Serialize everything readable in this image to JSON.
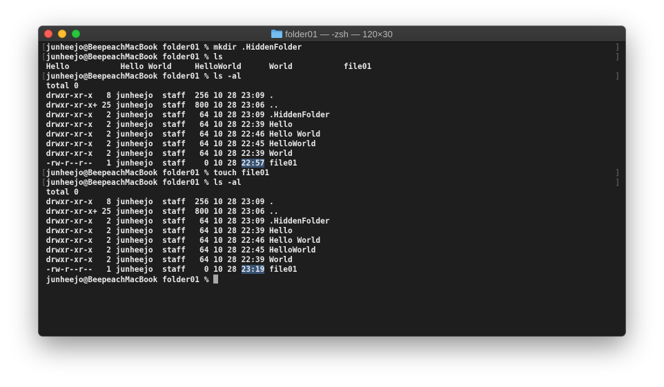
{
  "window": {
    "title": "folder01 — -zsh — 120×30",
    "title_icon": "folder-icon",
    "traffic_lights": {
      "close_color": "#fe5f57",
      "minimize_color": "#febc2e",
      "maximize_color": "#28c840"
    }
  },
  "terminal": {
    "background": "#1e1e1e",
    "text_color": "#e8e8e8",
    "selection_color": "#3a5472",
    "lines": [
      {
        "pre": "junheejo@BeepeachMacBook folder01 % mkdir .HiddenFolder",
        "hl": "",
        "post": "",
        "marked": true
      },
      {
        "pre": "junheejo@BeepeachMacBook folder01 % ls",
        "hl": "",
        "post": "",
        "marked": true
      },
      {
        "pre": "Hello           Hello World     HelloWorld      World           file01",
        "hl": "",
        "post": "",
        "marked": false
      },
      {
        "pre": "junheejo@BeepeachMacBook folder01 % ls -al",
        "hl": "",
        "post": "",
        "marked": true
      },
      {
        "pre": "total 0",
        "hl": "",
        "post": "",
        "marked": false
      },
      {
        "pre": "drwxr-xr-x   8 junheejo  staff  256 10 28 23:09 .",
        "hl": "",
        "post": "",
        "marked": false
      },
      {
        "pre": "drwxr-xr-x+ 25 junheejo  staff  800 10 28 23:06 ..",
        "hl": "",
        "post": "",
        "marked": false
      },
      {
        "pre": "drwxr-xr-x   2 junheejo  staff   64 10 28 23:09 .HiddenFolder",
        "hl": "",
        "post": "",
        "marked": false
      },
      {
        "pre": "drwxr-xr-x   2 junheejo  staff   64 10 28 22:39 Hello",
        "hl": "",
        "post": "",
        "marked": false
      },
      {
        "pre": "drwxr-xr-x   2 junheejo  staff   64 10 28 22:46 Hello World",
        "hl": "",
        "post": "",
        "marked": false
      },
      {
        "pre": "drwxr-xr-x   2 junheejo  staff   64 10 28 22:45 HelloWorld",
        "hl": "",
        "post": "",
        "marked": false
      },
      {
        "pre": "drwxr-xr-x   2 junheejo  staff   64 10 28 22:39 World",
        "hl": "",
        "post": "",
        "marked": false
      },
      {
        "pre": "-rw-r--r--   1 junheejo  staff    0 10 28 ",
        "hl": "22:57",
        "post": " file01",
        "marked": false
      },
      {
        "pre": "junheejo@BeepeachMacBook folder01 % touch file01",
        "hl": "",
        "post": "",
        "marked": true
      },
      {
        "pre": "junheejo@BeepeachMacBook folder01 % ls -al",
        "hl": "",
        "post": "",
        "marked": true
      },
      {
        "pre": "total 0",
        "hl": "",
        "post": "",
        "marked": false
      },
      {
        "pre": "drwxr-xr-x   8 junheejo  staff  256 10 28 23:09 .",
        "hl": "",
        "post": "",
        "marked": false
      },
      {
        "pre": "drwxr-xr-x+ 25 junheejo  staff  800 10 28 23:06 ..",
        "hl": "",
        "post": "",
        "marked": false
      },
      {
        "pre": "drwxr-xr-x   2 junheejo  staff   64 10 28 23:09 .HiddenFolder",
        "hl": "",
        "post": "",
        "marked": false
      },
      {
        "pre": "drwxr-xr-x   2 junheejo  staff   64 10 28 22:39 Hello",
        "hl": "",
        "post": "",
        "marked": false
      },
      {
        "pre": "drwxr-xr-x   2 junheejo  staff   64 10 28 22:46 Hello World",
        "hl": "",
        "post": "",
        "marked": false
      },
      {
        "pre": "drwxr-xr-x   2 junheejo  staff   64 10 28 22:45 HelloWorld",
        "hl": "",
        "post": "",
        "marked": false
      },
      {
        "pre": "drwxr-xr-x   2 junheejo  staff   64 10 28 22:39 World",
        "hl": "",
        "post": "",
        "marked": false
      },
      {
        "pre": "-rw-r--r--   1 junheejo  staff    0 10 28 ",
        "hl": "23:19",
        "post": " file01",
        "marked": false
      }
    ],
    "prompt": "junheejo@BeepeachMacBook folder01 % "
  }
}
